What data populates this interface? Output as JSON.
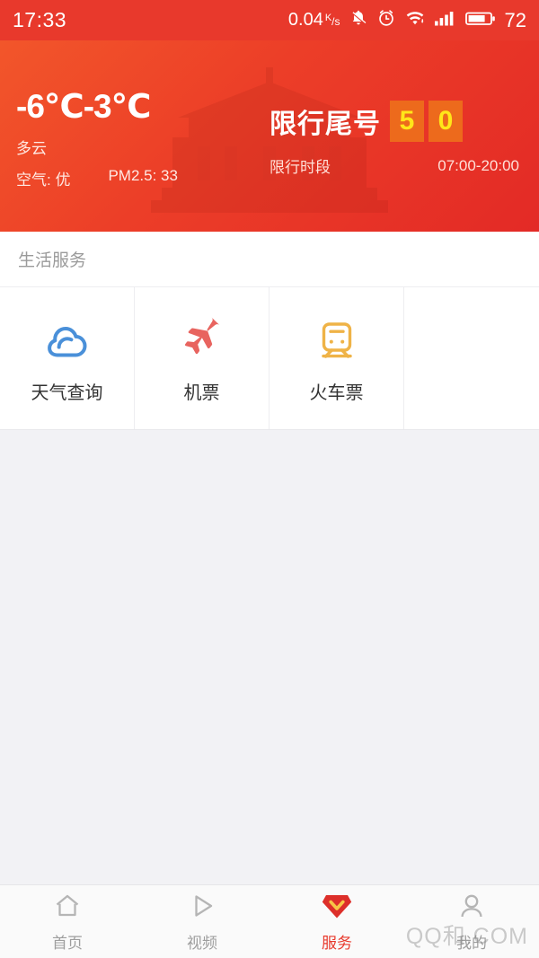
{
  "statusbar": {
    "time": "17:33",
    "network_speed": "0.04",
    "network_unit_k": "K",
    "network_unit_s": "/s",
    "battery_level": "72",
    "icons": [
      "bell-muted-icon",
      "alarm-clock-icon",
      "wifi-icon",
      "signal-bars-icon",
      "battery-icon"
    ]
  },
  "header": {
    "temperature": "-6℃-3℃",
    "condition": "多云",
    "air_quality": "空气: 优",
    "pm25": "PM2.5: 33",
    "restriction_title": "限行尾号",
    "restriction_numbers": [
      "5",
      "0"
    ],
    "restriction_period_label": "限行时段",
    "restriction_period_value": "07:00-20:00",
    "colors": {
      "gradient_start": "#f2562a",
      "gradient_end": "#e32a26",
      "number_box": "#ed6a1c",
      "number_text": "#ffe619"
    }
  },
  "section": {
    "title": "生活服务"
  },
  "services": [
    {
      "label": "天气查询",
      "icon": "cloud-icon",
      "color": "#4a90d9"
    },
    {
      "label": "机票",
      "icon": "airplane-icon",
      "color": "#e8645f"
    },
    {
      "label": "火车票",
      "icon": "train-icon",
      "color": "#efb347"
    }
  ],
  "bottomnav": {
    "items": [
      {
        "label": "首页",
        "icon": "home-icon",
        "active": false
      },
      {
        "label": "视频",
        "icon": "play-triangle-icon",
        "active": false
      },
      {
        "label": "服务",
        "icon": "diamond-icon",
        "active": true
      },
      {
        "label": "我的",
        "icon": "person-icon",
        "active": false
      }
    ],
    "active_color": "#e8392c",
    "inactive_color": "#9e9e9e"
  },
  "watermark": {
    "text": "QQ和.COM"
  }
}
